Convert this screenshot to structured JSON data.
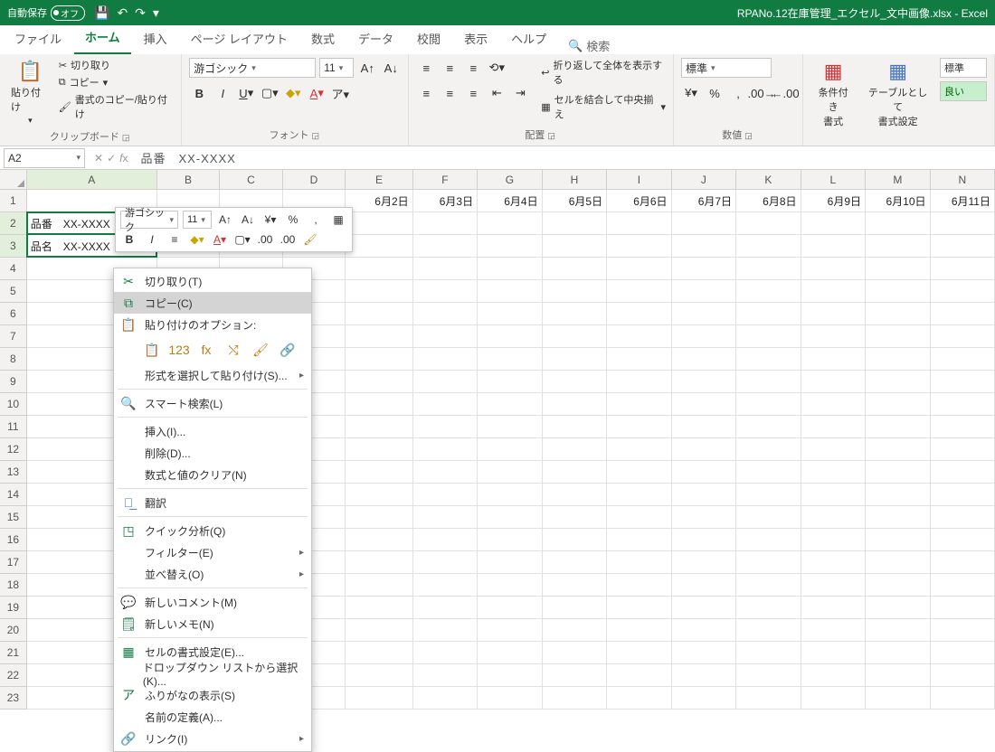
{
  "title": {
    "autosave_label": "自動保存",
    "autosave_state": "オフ",
    "filename": "RPANo.12在庫管理_エクセル_文中画像.xlsx  -  Excel"
  },
  "qat": {
    "save": "💾",
    "undo": "↶",
    "redo": "↷"
  },
  "tabs": {
    "file": "ファイル",
    "home": "ホーム",
    "insert": "挿入",
    "layout": "ページ レイアウト",
    "formulas": "数式",
    "data": "データ",
    "review": "校閲",
    "view": "表示",
    "help": "ヘルプ",
    "search": "検索"
  },
  "ribbon": {
    "clipboard": {
      "paste": "貼り付け",
      "cut": "切り取り",
      "copy": "コピー",
      "formatpainter": "書式のコピー/貼り付け",
      "label": "クリップボード"
    },
    "font": {
      "name": "游ゴシック",
      "size": "11",
      "label": "フォント"
    },
    "align": {
      "wrap": "折り返して全体を表示する",
      "merge": "セルを結合して中央揃え",
      "label": "配置"
    },
    "number": {
      "format": "標準",
      "label": "数値"
    },
    "styles": {
      "condfmt": "条件付き\n書式",
      "tablefmt": "テーブルとして\n書式設定",
      "normal": "標準",
      "good": "良い"
    }
  },
  "namebox": "A2",
  "formula": "品番　XX-XXXX",
  "columns": [
    "A",
    "B",
    "C",
    "D",
    "E",
    "F",
    "G",
    "H",
    "I",
    "J",
    "K",
    "L",
    "M",
    "N"
  ],
  "dates": [
    "6月2日",
    "6月3日",
    "6月4日",
    "6月5日",
    "6月6日",
    "6月7日",
    "6月8日",
    "6月9日",
    "6月10日",
    "6月11日"
  ],
  "rows": 23,
  "cells": {
    "a2": "品番　XX-XXXX",
    "a3": "品名　XX-XXXX"
  },
  "minitb": {
    "font": "游ゴシック",
    "size": "11"
  },
  "ctx": {
    "cut": "切り取り(T)",
    "copy": "コピー(C)",
    "pasteopt": "貼り付けのオプション:",
    "pastespecial": "形式を選択して貼り付け(S)...",
    "smart": "スマート検索(L)",
    "insert": "挿入(I)...",
    "delete": "削除(D)...",
    "clear": "数式と値のクリア(N)",
    "translate": "翻訳",
    "quick": "クイック分析(Q)",
    "filter": "フィルター(E)",
    "sort": "並べ替え(O)",
    "comment": "新しいコメント(M)",
    "memo": "新しいメモ(N)",
    "format": "セルの書式設定(E)...",
    "dropdown": "ドロップダウン リストから選択(K)...",
    "furigana": "ふりがなの表示(S)",
    "definename": "名前の定義(A)...",
    "link": "リンク(I)"
  }
}
